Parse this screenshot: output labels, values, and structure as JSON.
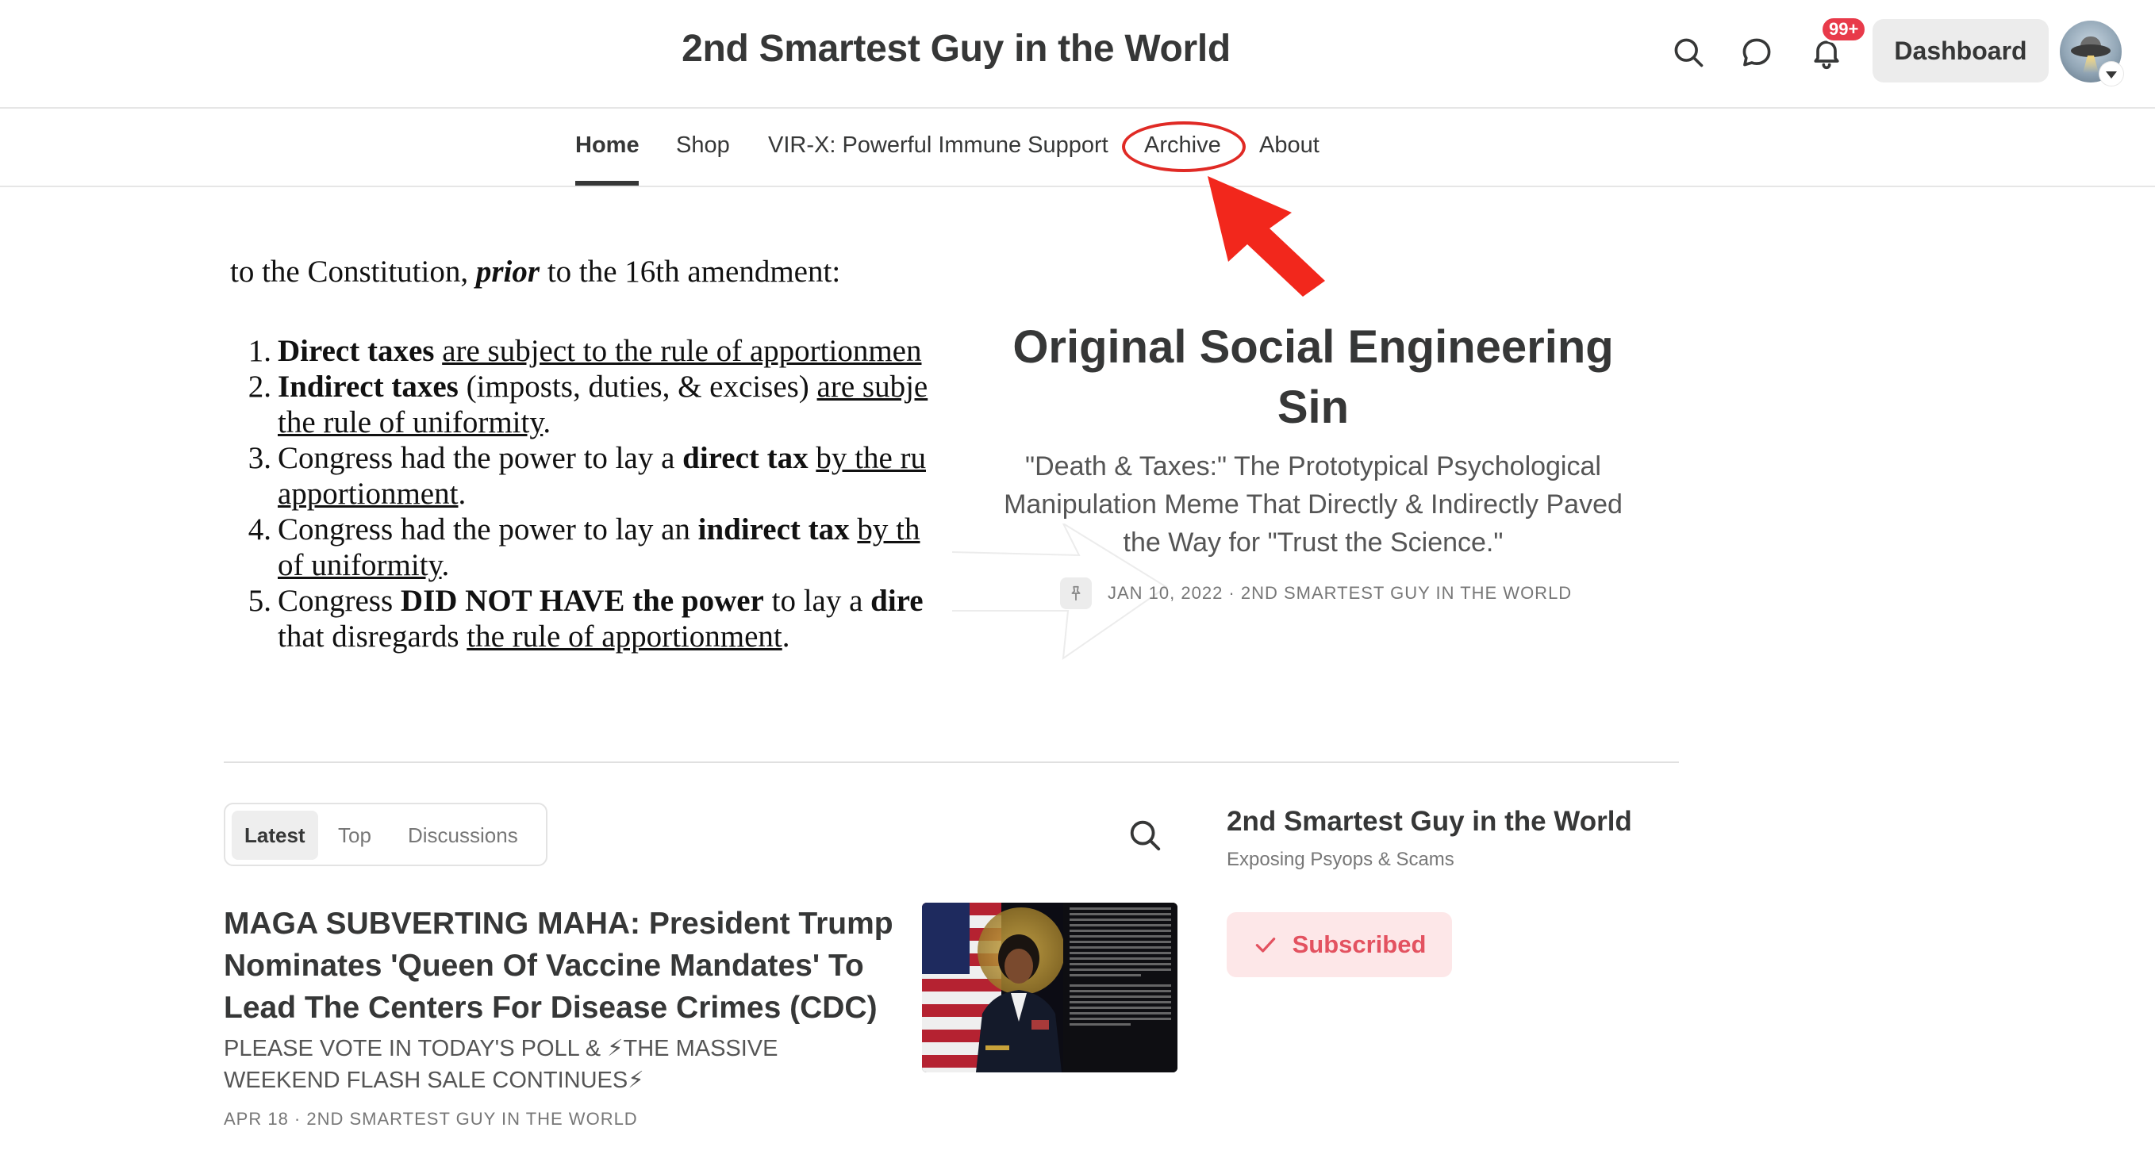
{
  "header": {
    "site_title": "2nd Smartest Guy in the World",
    "notification_count": "99+",
    "dashboard_label": "Dashboard"
  },
  "icons": {
    "search": "search-icon",
    "chat": "chat-bubble-icon",
    "bell": "bell-icon",
    "pin": "pin-icon",
    "check": "check-icon"
  },
  "nav": {
    "items": [
      {
        "label": "Home",
        "active": true
      },
      {
        "label": "Shop"
      },
      {
        "label": "VIR-X: Powerful Immune Support"
      },
      {
        "label": "Archive",
        "highlighted": true
      },
      {
        "label": "About"
      }
    ]
  },
  "featured": {
    "image_text": {
      "intro_pre": "to the Constitution, ",
      "intro_em": "prior",
      "intro_post": " to the 16th amendment:",
      "items": [
        {
          "num": "1.",
          "b1": "Direct taxes",
          "t1": " ",
          "u1": "are subject to the rule of apportionmen"
        },
        {
          "num": "2.",
          "b1": "Indirect taxes",
          "t1": " (imposts, duties, & excises) ",
          "u1": "are subje",
          "u2": "the rule of uniformity",
          "t2": "."
        },
        {
          "num": "3.",
          "t0": "Congress had the power to lay a ",
          "b1": "direct tax",
          "t1": " ",
          "u1": "by the ru",
          "u2": "apportionment",
          "t2": "."
        },
        {
          "num": "4.",
          "t0": "Congress had the power to lay an ",
          "b1": "indirect tax",
          "t1": " ",
          "u1": "by th",
          "u2": "of uniformity",
          "t2": "."
        },
        {
          "num": "5.",
          "t0": "Congress ",
          "b1": "DID NOT HAVE the power",
          "t1": " to lay a ",
          "b2": "dire",
          "t2a": "that disregards ",
          "u2": "the rule of apportionment",
          "t2": "."
        }
      ]
    },
    "title": "Original Social Engineering Sin",
    "subtitle": "\"Death & Taxes:\" The Prototypical Psychological Manipulation Meme That Directly & Indirectly Paved the Way for \"Trust the Science.\"",
    "meta": "JAN 10, 2022 · 2ND SMARTEST GUY IN THE WORLD"
  },
  "tabs": [
    {
      "label": "Latest",
      "active": true
    },
    {
      "label": "Top"
    },
    {
      "label": "Discussions"
    }
  ],
  "post": {
    "title": "MAGA SUBVERTING MAHA: President Trump Nominates 'Queen Of Vaccine Mandates' To Lead The Centers For Disease Crimes (CDC)",
    "subtitle": "PLEASE VOTE IN TODAY'S POLL & ⚡THE MASSIVE WEEKEND FLASH SALE CONTINUES⚡",
    "meta": "APR 18 · 2ND SMARTEST GUY IN THE WORLD"
  },
  "sidebar": {
    "title": "2nd Smartest Guy in the World",
    "tagline": "Exposing Psyops & Scams",
    "subscribed_label": "Subscribed"
  },
  "colors": {
    "text": "#363737",
    "annotation_red": "#e02a25",
    "badge_red": "#e83a4a",
    "subscribed_bg": "#fde7e8",
    "subscribed_fg": "#e35260"
  }
}
